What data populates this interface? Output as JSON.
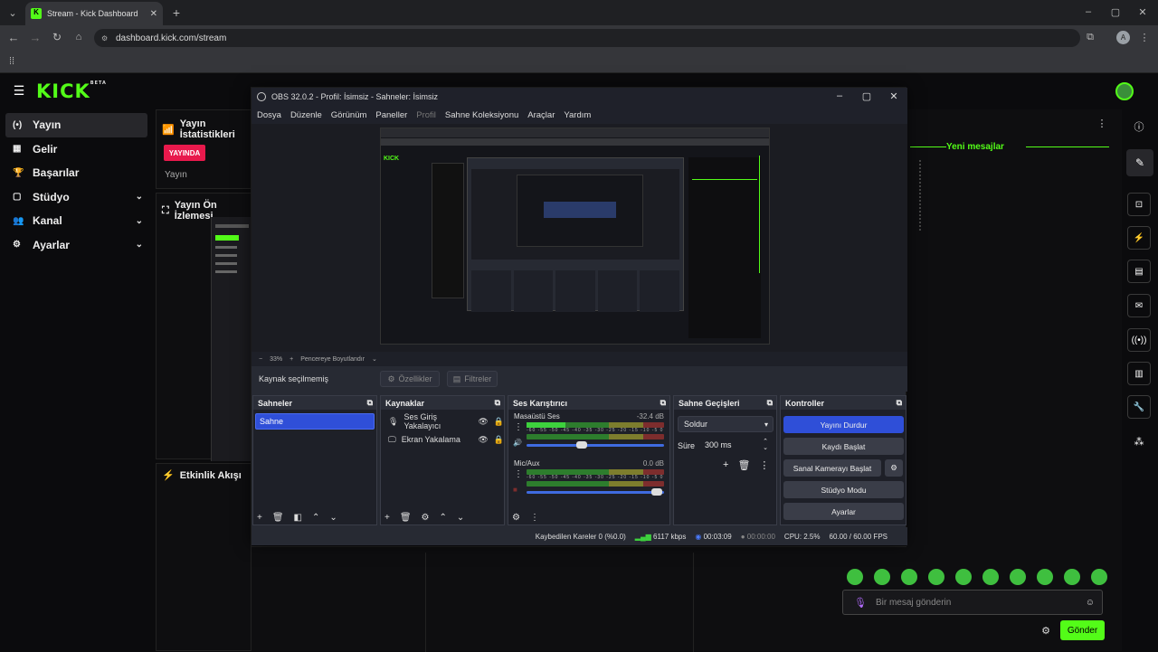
{
  "browser": {
    "tab_title": "Stream - Kick Dashboard",
    "url": "dashboard.kick.com/stream",
    "avatar_letter": "A"
  },
  "kick": {
    "logo": "KICK",
    "logo_badge": "BETA",
    "sidebar": [
      {
        "label": "Yayın",
        "icon": "broadcast-icon",
        "active": true,
        "expandable": false
      },
      {
        "label": "Gelir",
        "icon": "revenue-icon",
        "active": false,
        "expandable": false
      },
      {
        "label": "Başarılar",
        "icon": "trophy-icon",
        "active": false,
        "expandable": false
      },
      {
        "label": "Stüdyo",
        "icon": "studio-icon",
        "active": false,
        "expandable": true
      },
      {
        "label": "Kanal",
        "icon": "channel-icon",
        "active": false,
        "expandable": true
      },
      {
        "label": "Ayarlar",
        "icon": "gear-icon",
        "active": false,
        "expandable": true
      }
    ],
    "stats_title": "Yayın İstatistikleri",
    "live_badge": "YAYINDA",
    "stats_label": "Yayın",
    "preview_title": "Yayın Ön İzlemesi",
    "activity_title": "Etkinlik Akışı",
    "chat_new_messages": "Yeni mesajlar",
    "chat_placeholder": "Bir mesaj gönderin",
    "send_label": "Gönder",
    "accent": "#53fc18",
    "live_color": "#e8194c"
  },
  "obs": {
    "title": "OBS 32.0.2 - Profil: İsimsiz - Sahneler: İsimsiz",
    "menu": [
      "Dosya",
      "Düzenle",
      "Görünüm",
      "Paneller",
      "Profil",
      "Sahne Koleksiyonu",
      "Araçlar",
      "Yardım"
    ],
    "zoom": "33%",
    "fit_label": "Pencereye Boyutlandır",
    "no_source": "Kaynak seçilmemiş",
    "properties_label": "Özellikler",
    "filters_label": "Filtreler",
    "scenes_title": "Sahneler",
    "scenes": [
      "Sahne"
    ],
    "sources_title": "Kaynaklar",
    "sources": [
      {
        "name": "Ses Giriş Yakalayıcı",
        "icon": "mic-icon"
      },
      {
        "name": "Ekran Yakalama",
        "icon": "monitor-icon"
      }
    ],
    "mixer_title": "Ses Karıştırıcı",
    "mixer": [
      {
        "name": "Masaüstü Ses",
        "db": "-32.4 dB",
        "level": 0.28,
        "volume": 0.4
      },
      {
        "name": "Mic/Aux",
        "db": "0.0 dB",
        "level": 0.0,
        "volume": 0.95
      }
    ],
    "meter_ticks": "-60 -55 -50 -45 -40 -35 -30 -25 -20 -15 -10 -5 0",
    "transitions_title": "Sahne Geçişleri",
    "transition": "Soldur",
    "duration_label": "Süre",
    "duration_value": "300 ms",
    "controls_title": "Kontroller",
    "controls": [
      "Yayını Durdur",
      "Kaydı Başlat",
      "Sanal Kamerayı Başlat",
      "Stüdyo Modu",
      "Ayarlar"
    ],
    "status": {
      "dropped": "Kaybedilen Kareler 0 (%0.0)",
      "bitrate": "6117 kbps",
      "stream_time": "00:03:09",
      "rec_time": "00:00:00",
      "cpu": "CPU: 2.5%",
      "fps": "60.00 / 60.00 FPS"
    }
  }
}
